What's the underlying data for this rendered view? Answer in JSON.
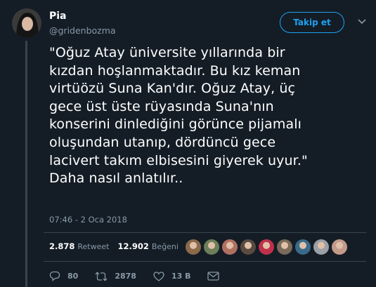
{
  "author": {
    "name": "Pia",
    "handle": "@gridenbozma"
  },
  "follow_button": {
    "label": "Takip et"
  },
  "tweet": {
    "text": "\"Oğuz Atay üniversite yıllarında bir\nkızdan hoşlanmaktadır. Bu kız keman\nvirtüözü Suna Kan'dır. Oğuz Atay, üç\ngece üst üste rüyasında Suna'nın\nkonserini dinlediğini görünce pijamalı\noluşundan utanıp, dördüncü gece\nlacivert takım elbisesini giyerek uyur.\"\nDaha nasıl anlatılır..",
    "timestamp": "07:46 - 2 Oca 2018"
  },
  "stats": {
    "retweets": {
      "count": "2.878",
      "label": "Retweet"
    },
    "likes": {
      "count": "12.902",
      "label": "Beğeni"
    }
  },
  "liker_avatars": [
    {
      "color": "#8a6a4a"
    },
    {
      "color": "#6b7f5a"
    },
    {
      "color": "#b07060"
    },
    {
      "color": "#5a4a40"
    },
    {
      "color": "#c0304a"
    },
    {
      "color": "#7a6a5a"
    },
    {
      "color": "#3a6a8a"
    },
    {
      "color": "#9aa0a6"
    },
    {
      "color": "#c49a8a"
    }
  ],
  "actions": {
    "replies": "80",
    "retweets": "2878",
    "likes": "13 B"
  },
  "colors": {
    "background": "#141d26",
    "accent": "#1da1f2",
    "muted": "#8899a6",
    "divider": "#38444d"
  }
}
